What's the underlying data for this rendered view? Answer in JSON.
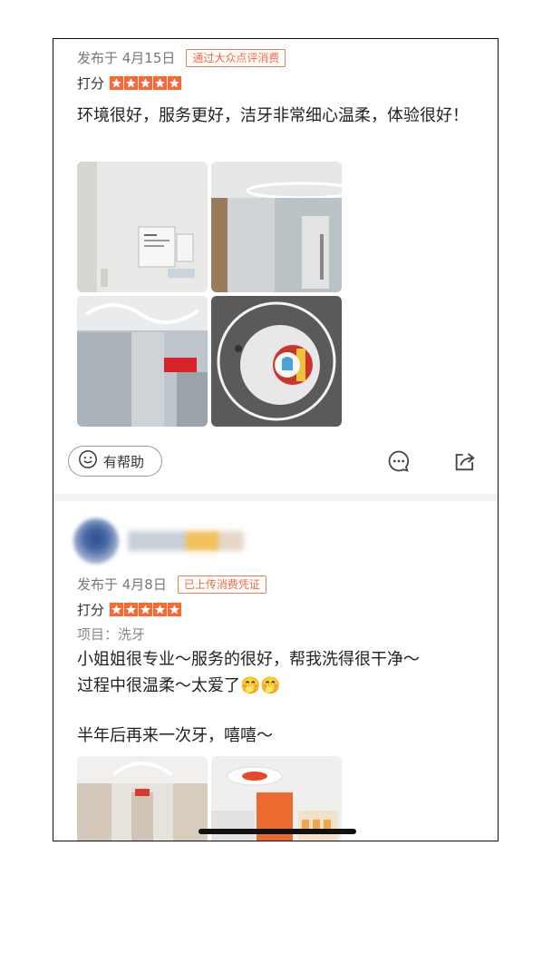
{
  "review1": {
    "published_date": "发布于 4月15日",
    "badge": "通过大众点评消费",
    "score_label": "打分",
    "rating": 5,
    "text": "环境很好，服务更好，洁牙非常细心温柔，体验很好！",
    "helpful_label": "有帮助"
  },
  "review2": {
    "published_date": "发布于 4月8日",
    "badge": "已上传消费凭证",
    "score_label": "打分",
    "rating": 5,
    "project": "项目：洗牙",
    "text_line1": "小姐姐很专业～服务的很好，帮我洗得很干净～",
    "text_line2": "过程中很温柔～太爱了",
    "emoji": "🤭🤭",
    "text_line3": "半年后再来一次牙，嘻嘻～"
  },
  "colors": {
    "accent": "#ff6633",
    "badge_border": "#f27a54",
    "divider": "#f2f2f2"
  },
  "icons": [
    "smile-icon",
    "comment-icon",
    "share-icon",
    "star-icon"
  ]
}
